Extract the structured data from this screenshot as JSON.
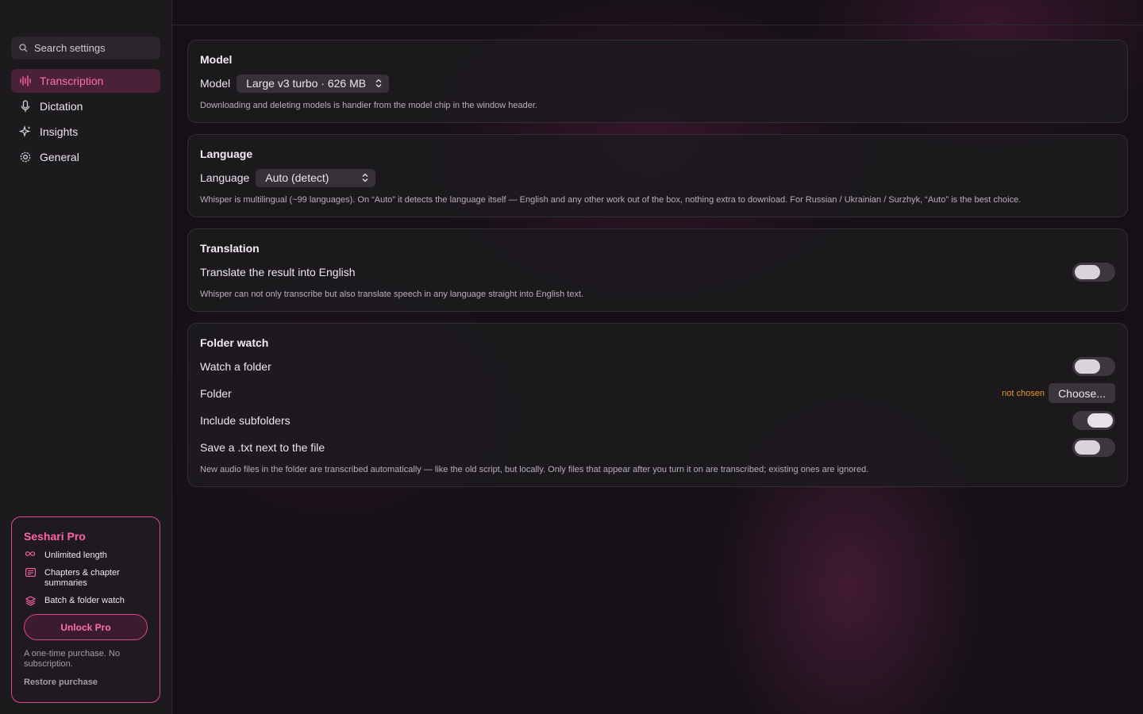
{
  "sidebar": {
    "search_placeholder": "Search settings",
    "items": [
      {
        "label": "Transcription",
        "icon": "waveform-icon",
        "active": true
      },
      {
        "label": "Dictation",
        "icon": "microphone-icon",
        "active": false
      },
      {
        "label": "Insights",
        "icon": "sparkle-icon",
        "active": false
      },
      {
        "label": "General",
        "icon": "gear-icon",
        "active": false
      }
    ],
    "pro": {
      "title": "Seshari Pro",
      "features": [
        {
          "label": "Unlimited length",
          "icon": "infinity-icon"
        },
        {
          "label": "Chapters & chapter summaries",
          "icon": "chapters-icon"
        },
        {
          "label": "Batch & folder watch",
          "icon": "layers-icon"
        }
      ],
      "unlock_label": "Unlock Pro",
      "note": "A one-time purchase. No subscription.",
      "restore_label": "Restore purchase"
    }
  },
  "sections": {
    "model": {
      "title": "Model",
      "label": "Model",
      "value": "Large v3 turbo · 626 MB",
      "hint": "Downloading and deleting models is handier from the model chip in the window header."
    },
    "language": {
      "title": "Language",
      "label": "Language",
      "value": "Auto (detect)",
      "hint": "Whisper is multilingual (~99 languages). On “Auto” it detects the language itself — English and any other work out of the box, nothing extra to download. For Russian / Ukrainian / Surzhyk, “Auto” is the best choice."
    },
    "translation": {
      "title": "Translation",
      "toggle_label": "Translate the result into English",
      "toggle_on": false,
      "hint": "Whisper can not only transcribe but also translate speech in any language straight into English text."
    },
    "folder_watch": {
      "title": "Folder watch",
      "watch_label": "Watch a folder",
      "watch_on": false,
      "folder_label": "Folder",
      "folder_status": "not chosen",
      "choose_label": "Choose...",
      "subfolders_label": "Include subfolders",
      "subfolders_on": true,
      "save_txt_label": "Save a .txt next to the file",
      "save_txt_on": false,
      "hint": "New audio files in the folder are transcribed automatically — like the old script, but locally. Only files that appear after you turn it on are transcribed; existing ones are ignored."
    }
  },
  "colors": {
    "accent": "#ff62a8",
    "warning": "#e8962a"
  }
}
